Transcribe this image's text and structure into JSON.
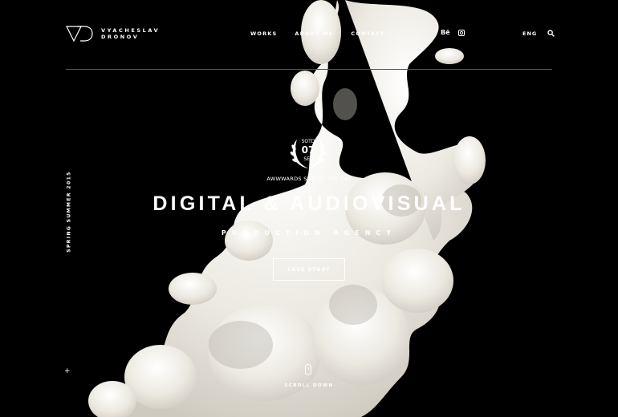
{
  "brand": {
    "line1": "VYACHESLAV",
    "line2": "DRONOV"
  },
  "nav": {
    "works": "WORKS",
    "about": "ABOUT ME",
    "contact": "CONTACT"
  },
  "social": {
    "behance": "Bē",
    "instagram_icon": "instagram-icon"
  },
  "lang": "ENG",
  "search_icon": "search-icon",
  "side_text": "SPRING SUMMER 2015",
  "badge": {
    "top": "SOTD",
    "day": "07",
    "month": "SEP"
  },
  "award_text": "AWWWARDS SITE OF THE DAY",
  "headline": "DIGITAL & AUDIOVISUAL",
  "subheadline": "PRODUCTION AGENCY",
  "cta_label": "CASE STUDY",
  "scroll_label": "SCROLL DOWN",
  "colors": {
    "background": "#000000",
    "ink": "#f2f0ea",
    "text": "#ffffff"
  }
}
